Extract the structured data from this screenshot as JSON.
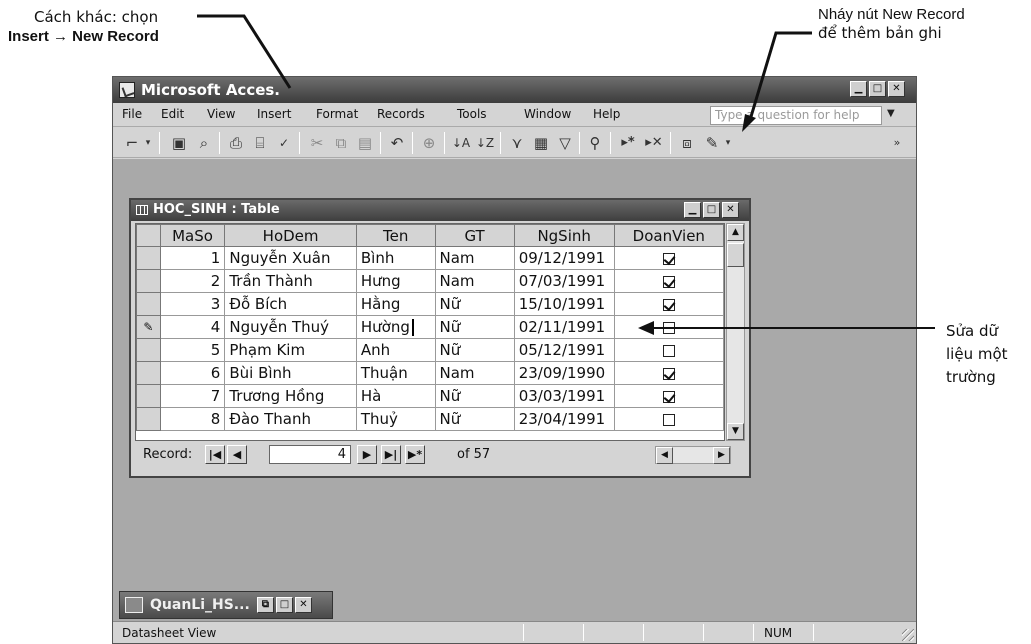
{
  "annotations": {
    "top_left_line1": "Cách khác: chọn",
    "top_left_line2": "Insert → New Record",
    "top_right_line1": "Nháy nút New Record",
    "top_right_line2": "để thêm bản ghi",
    "right_line1": "Sửa dữ",
    "right_line2": "liệu một",
    "right_line3": "trường"
  },
  "app": {
    "title": "Microsoft Acces.",
    "menu": [
      "File",
      "Edit",
      "View",
      "Insert",
      "Format",
      "Records",
      "Tools",
      "Window",
      "Help"
    ],
    "ask_placeholder": "Type a question for help",
    "status_text": "Datasheet View",
    "status_num": "NUM"
  },
  "table_window": {
    "title": "HOC_SINH : Table",
    "columns": [
      "MaSo",
      "HoDem",
      "Ten",
      "GT",
      "NgSinh",
      "DoanVien"
    ],
    "rows": [
      {
        "selector": "",
        "MaSo": "1",
        "HoDem": "Nguyễn Xuân",
        "Ten": "Bình",
        "GT": "Nam",
        "NgSinh": "09/12/1991",
        "DoanVien": true
      },
      {
        "selector": "",
        "MaSo": "2",
        "HoDem": "Trần Thành",
        "Ten": "Hưng",
        "GT": "Nam",
        "NgSinh": "07/03/1991",
        "DoanVien": true
      },
      {
        "selector": "",
        "MaSo": "3",
        "HoDem": "Đỗ Bích",
        "Ten": "Hằng",
        "GT": "Nữ",
        "NgSinh": "15/10/1991",
        "DoanVien": true
      },
      {
        "selector": "✎",
        "MaSo": "4",
        "HoDem": "Nguyễn Thuý",
        "Ten": "Hường",
        "GT": "Nữ",
        "NgSinh": "02/11/1991",
        "DoanVien": false
      },
      {
        "selector": "",
        "MaSo": "5",
        "HoDem": "Phạm Kim",
        "Ten": "Anh",
        "GT": "Nữ",
        "NgSinh": "05/12/1991",
        "DoanVien": false
      },
      {
        "selector": "",
        "MaSo": "6",
        "HoDem": "Bùi Bình",
        "Ten": "Thuận",
        "GT": "Nam",
        "NgSinh": "23/09/1990",
        "DoanVien": true
      },
      {
        "selector": "",
        "MaSo": "7",
        "HoDem": "Trương Hồng",
        "Ten": "Hà",
        "GT": "Nữ",
        "NgSinh": "03/03/1991",
        "DoanVien": true
      },
      {
        "selector": "",
        "MaSo": "8",
        "HoDem": "Đào Thanh",
        "Ten": "Thuỷ",
        "GT": "Nữ",
        "NgSinh": "23/04/1991",
        "DoanVien": false
      }
    ],
    "nav": {
      "label": "Record:",
      "current": "4",
      "of_text": "of 57"
    }
  },
  "db_window": {
    "title": "QuanLi_HS..."
  }
}
